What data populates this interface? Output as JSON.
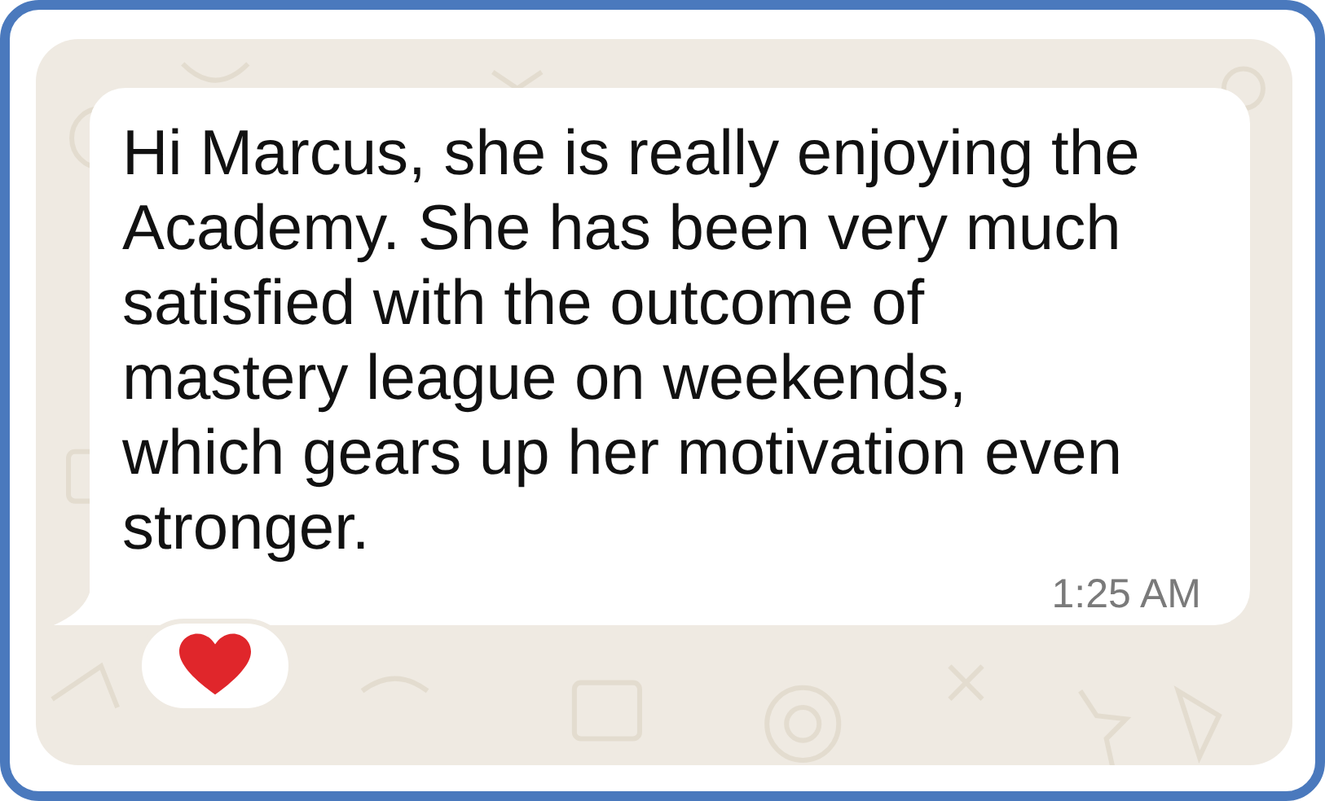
{
  "message": {
    "text": "Hi Marcus, she is really enjoying the\nAcademy. She has been very much\nsatisfied with the outcome of\nmastery league on weekends,\nwhich gears up her motivation even\nstronger.",
    "time": "1:25 AM",
    "reaction": {
      "kind": "heart"
    }
  }
}
